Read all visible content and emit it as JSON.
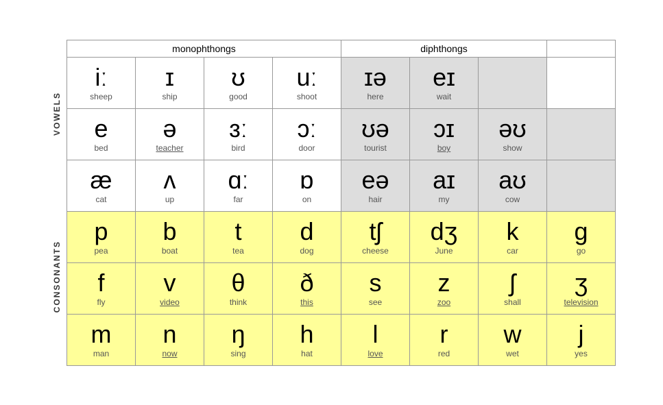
{
  "labels": {
    "vowels": "VOWELS",
    "consonants": "CONSONANTS",
    "monophthongs": "monophthongs",
    "diphthongs": "diphthongs"
  },
  "vowelRows": [
    {
      "cells": [
        {
          "symbol": "iː",
          "word": "sheep",
          "type": "mono"
        },
        {
          "symbol": "ɪ",
          "word": "ship",
          "type": "mono"
        },
        {
          "symbol": "ʊ",
          "word": "good",
          "type": "mono"
        },
        {
          "symbol": "uː",
          "word": "shoot",
          "type": "mono"
        },
        {
          "symbol": "ɪə",
          "word": "here",
          "type": "di"
        },
        {
          "symbol": "eɪ",
          "word": "wait",
          "type": "di"
        },
        {
          "symbol": "",
          "word": "",
          "type": "empty"
        }
      ]
    },
    {
      "cells": [
        {
          "symbol": "e",
          "word": "bed",
          "type": "mono"
        },
        {
          "symbol": "ə",
          "word": "teacher",
          "type": "mono",
          "wordClass": "underline"
        },
        {
          "symbol": "ɜː",
          "word": "bird",
          "type": "mono"
        },
        {
          "symbol": "ɔː",
          "word": "door",
          "type": "mono"
        },
        {
          "symbol": "ʊə",
          "word": "tourist",
          "type": "di"
        },
        {
          "symbol": "ɔɪ",
          "word": "boy",
          "type": "di",
          "wordClass": "underline"
        },
        {
          "symbol": "əʊ",
          "word": "show",
          "type": "di"
        }
      ]
    },
    {
      "cells": [
        {
          "symbol": "æ",
          "word": "cat",
          "type": "mono"
        },
        {
          "symbol": "ʌ",
          "word": "up",
          "type": "mono"
        },
        {
          "symbol": "ɑː",
          "word": "far",
          "type": "mono"
        },
        {
          "symbol": "ɒ",
          "word": "on",
          "type": "mono"
        },
        {
          "symbol": "eə",
          "word": "hair",
          "type": "di"
        },
        {
          "symbol": "aɪ",
          "word": "my",
          "type": "di"
        },
        {
          "symbol": "aʊ",
          "word": "cow",
          "type": "di"
        }
      ]
    }
  ],
  "consonantRows": [
    {
      "cells": [
        {
          "symbol": "p",
          "word": "pea"
        },
        {
          "symbol": "b",
          "word": "boat"
        },
        {
          "symbol": "t",
          "word": "tea"
        },
        {
          "symbol": "d",
          "word": "dog"
        },
        {
          "symbol": "tʃ",
          "word": "cheese"
        },
        {
          "symbol": "dʒ",
          "word": "June"
        },
        {
          "symbol": "k",
          "word": "car"
        },
        {
          "symbol": "g",
          "word": "go"
        }
      ]
    },
    {
      "cells": [
        {
          "symbol": "f",
          "word": "fly"
        },
        {
          "symbol": "v",
          "word": "video",
          "wordClass": "underline"
        },
        {
          "symbol": "θ",
          "word": "think"
        },
        {
          "symbol": "ð",
          "word": "this",
          "wordClass": "underline"
        },
        {
          "symbol": "s",
          "word": "see"
        },
        {
          "symbol": "z",
          "word": "zoo",
          "wordClass": "underline"
        },
        {
          "symbol": "ʃ",
          "word": "shall"
        },
        {
          "symbol": "ʒ",
          "word": "television",
          "wordClass": "underline"
        }
      ]
    },
    {
      "cells": [
        {
          "symbol": "m",
          "word": "man"
        },
        {
          "symbol": "n",
          "word": "now",
          "wordClass": "underline"
        },
        {
          "symbol": "ŋ",
          "word": "sing"
        },
        {
          "symbol": "h",
          "word": "hat"
        },
        {
          "symbol": "l",
          "word": "love",
          "wordClass": "underline"
        },
        {
          "symbol": "r",
          "word": "red"
        },
        {
          "symbol": "w",
          "word": "wet"
        },
        {
          "symbol": "j",
          "word": "yes"
        }
      ]
    }
  ]
}
